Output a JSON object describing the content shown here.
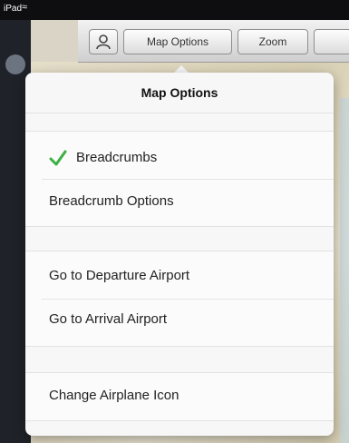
{
  "status_bar": {
    "carrier": "iPad",
    "wifi_icon": "wifi-icon"
  },
  "toolbar": {
    "map_options_label": "Map Options",
    "zoom_label": "Zoom"
  },
  "popover": {
    "title": "Map Options",
    "items": [
      {
        "label": "Breadcrumbs",
        "checked": true
      },
      {
        "label": "Breadcrumb Options"
      },
      {
        "label": "Go to Departure Airport"
      },
      {
        "label": "Go to Arrival Airport"
      },
      {
        "label": "Change Airplane Icon"
      }
    ]
  },
  "colors": {
    "check": "#3cb043",
    "status_bar": "#0e0e10",
    "sidebar": "#1f2329"
  }
}
